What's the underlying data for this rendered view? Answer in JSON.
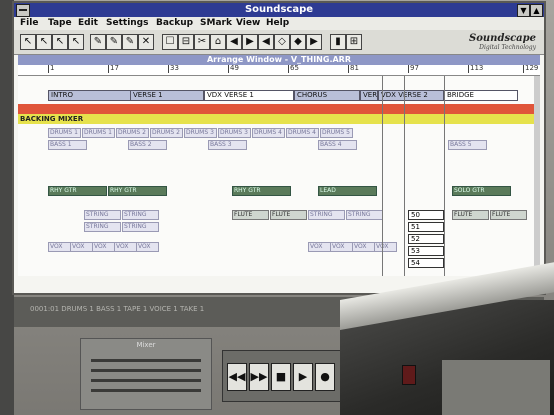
{
  "window": {
    "title": "Soundscape",
    "minimize": "▼",
    "maximize": "▲"
  },
  "menu": [
    "File",
    "Tape",
    "Edit",
    "Settings",
    "Backup",
    "SMark",
    "View",
    "Help"
  ],
  "toolbar": {
    "tools": [
      "↖",
      "↖",
      "↖",
      "↖",
      "✎",
      "✎",
      "✎",
      "✕",
      "☐",
      "⊟",
      "✂",
      "⌂",
      "◀",
      "▶",
      "◀",
      "◇",
      "◆",
      "▶",
      "▮",
      "⊞"
    ],
    "logo_line1": "Soundscape",
    "logo_line2": "Digital Technology"
  },
  "arrange_window": {
    "title": "Arrange Window - V_THING.ARR"
  },
  "ruler": {
    "labels": [
      "1",
      "17",
      "33",
      "49",
      "65",
      "81",
      "97",
      "113",
      "129"
    ]
  },
  "markers": [
    "INTRO",
    "VERSE 1",
    "VDX VERSE 1",
    "CHORUS",
    "VERSE",
    "VDX VERSE 2",
    "BRIDGE"
  ],
  "tracks": {
    "red_label": "",
    "yellow_label": "BACKING MIXER"
  },
  "clips": {
    "row1": [
      "DRUMS 1",
      "DRUMS 1",
      "DRUMS 2",
      "DRUMS 2",
      "DRUMS 3",
      "DRUMS 3",
      "DRUMS 4",
      "DRUMS 4",
      "DRUMS 5"
    ],
    "row2": [
      "BASS 1",
      "BASS 2",
      "BASS 3",
      "BASS 4",
      "BASS 5"
    ],
    "green_row": [
      "RHY GTR",
      "RHY GTR",
      "RHY GTR",
      "LEAD",
      "SOLO GTR"
    ],
    "flute": [
      "FLUTE",
      "FLUTE",
      "FLUTE",
      "FLUTE"
    ],
    "strings": [
      "STRING",
      "STRING",
      "STRING",
      "STRING",
      "STRING",
      "STRING"
    ],
    "bottom": [
      "VOX",
      "VOX",
      "VOX",
      "VOX",
      "VOX",
      "VOX",
      "VOX",
      "VOX",
      "VOX"
    ]
  },
  "numbers": [
    "50",
    "51",
    "52",
    "53",
    "54"
  ],
  "transport_row": "0001:01   DRUMS 1   BASS 1   TAPE 1   VOICE 1   TAKE 1",
  "mixer_title": "Mixer",
  "transport_buttons": [
    "◀◀",
    "▶▶",
    "■",
    "▶",
    "●"
  ]
}
